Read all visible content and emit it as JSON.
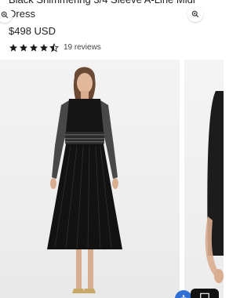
{
  "product": {
    "title_line1": "Black Shimmering 3/4 Sleeve A-Line Midi",
    "title_line2": "Dress",
    "price": "$498 USD",
    "rating": 4.5,
    "reviews_label": "19 reviews"
  },
  "gallery": {
    "zoom_icon": "zoom-in-icon",
    "product_image_alt": "Model wearing black pleated midi dress with belt"
  },
  "colors": {
    "text": "#1f1f1f",
    "accent_blue": "#2f6fd6",
    "image_bg": "#efefef"
  }
}
